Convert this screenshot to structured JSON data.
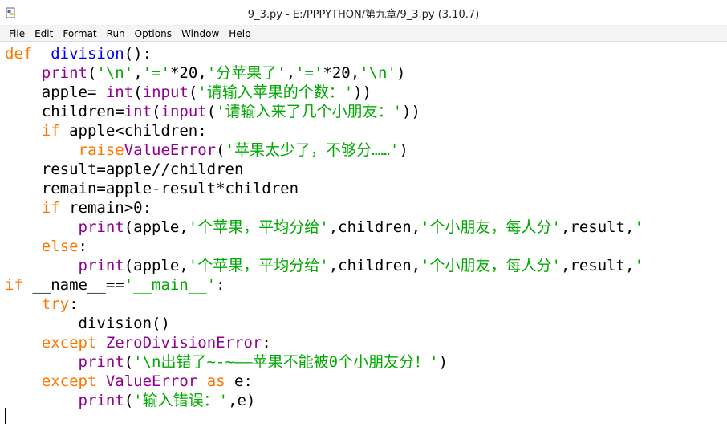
{
  "window": {
    "title": "9_3.py - E:/PPPYTHON/第九章/9_3.py (3.10.7)"
  },
  "menu": [
    "File",
    "Edit",
    "Format",
    "Run",
    "Options",
    "Window",
    "Help"
  ],
  "colors": {
    "keyword": "#ff7700",
    "builtin": "#900090",
    "string": "#00aa00",
    "definition": "#0000ff"
  },
  "code": [
    [
      [
        "kw",
        "def"
      ],
      [
        "",
        "  "
      ],
      [
        "df",
        "division"
      ],
      [
        "",
        "():"
      ]
    ],
    [
      [
        "",
        "    "
      ],
      [
        "bi",
        "print"
      ],
      [
        "",
        "("
      ],
      [
        "st",
        "'\\n'"
      ],
      [
        "",
        ","
      ],
      [
        "st",
        "'='"
      ],
      [
        "",
        "*20,"
      ],
      [
        "st",
        "'分苹果了'"
      ],
      [
        "",
        ","
      ],
      [
        "st",
        "'='"
      ],
      [
        "",
        "*20,"
      ],
      [
        "st",
        "'\\n'"
      ],
      [
        "",
        ")"
      ]
    ],
    [
      [
        "",
        "    apple= "
      ],
      [
        "bi",
        "int"
      ],
      [
        "",
        "("
      ],
      [
        "bi",
        "input"
      ],
      [
        "",
        "("
      ],
      [
        "st",
        "'请输入苹果的个数：'"
      ],
      [
        "",
        "))"
      ]
    ],
    [
      [
        "",
        "    children="
      ],
      [
        "bi",
        "int"
      ],
      [
        "",
        "("
      ],
      [
        "bi",
        "input"
      ],
      [
        "",
        "("
      ],
      [
        "st",
        "'请输入来了几个小朋友：'"
      ],
      [
        "",
        "))"
      ]
    ],
    [
      [
        "",
        "    "
      ],
      [
        "kw",
        "if"
      ],
      [
        "",
        " apple<children:"
      ]
    ],
    [
      [
        "",
        "        "
      ],
      [
        "kw",
        "raise"
      ],
      [
        "",
        "",
        " "
      ],
      [
        "bi",
        "ValueError"
      ],
      [
        "",
        "("
      ],
      [
        "st",
        "'苹果太少了，不够分……'"
      ],
      [
        "",
        ")"
      ]
    ],
    [
      [
        "",
        "    result=apple//children"
      ]
    ],
    [
      [
        "",
        "    remain=apple-result*children"
      ]
    ],
    [
      [
        "",
        "    "
      ],
      [
        "kw",
        "if"
      ],
      [
        "",
        " remain>0:"
      ]
    ],
    [
      [
        "",
        "        "
      ],
      [
        "bi",
        "print"
      ],
      [
        "",
        "(apple,"
      ],
      [
        "st",
        "'个苹果，平均分给'"
      ],
      [
        "",
        ",children,"
      ],
      [
        "st",
        "'个小朋友，每人分'"
      ],
      [
        "",
        ",result,"
      ],
      [
        "st",
        "'"
      ]
    ],
    [
      [
        "",
        "    "
      ],
      [
        "kw",
        "else"
      ],
      [
        "",
        ":"
      ]
    ],
    [
      [
        "",
        "        "
      ],
      [
        "bi",
        "print"
      ],
      [
        "",
        "(apple,"
      ],
      [
        "st",
        "'个苹果，平均分给'"
      ],
      [
        "",
        ",children,"
      ],
      [
        "st",
        "'个小朋友，每人分'"
      ],
      [
        "",
        ",result,"
      ],
      [
        "st",
        "'"
      ]
    ],
    [
      [
        "kw",
        "if"
      ],
      [
        "",
        " __name__=="
      ],
      [
        "st",
        "'__main__'"
      ],
      [
        "",
        ":"
      ]
    ],
    [
      [
        "",
        "    "
      ],
      [
        "kw",
        "try"
      ],
      [
        "",
        ":"
      ]
    ],
    [
      [
        "",
        "        division()"
      ]
    ],
    [
      [
        "",
        "    "
      ],
      [
        "kw",
        "except"
      ],
      [
        "",
        " "
      ],
      [
        "bi",
        "ZeroDivisionError"
      ],
      [
        "",
        ":"
      ]
    ],
    [
      [
        "",
        "        "
      ],
      [
        "bi",
        "print"
      ],
      [
        "",
        "("
      ],
      [
        "st",
        "'\\n出错了~-~——苹果不能被0个小朋友分！'"
      ],
      [
        "",
        ")"
      ]
    ],
    [
      [
        "",
        "    "
      ],
      [
        "kw",
        "except"
      ],
      [
        "",
        " "
      ],
      [
        "bi",
        "ValueError"
      ],
      [
        "",
        " "
      ],
      [
        "kw",
        "as"
      ],
      [
        "",
        " e:"
      ]
    ],
    [
      [
        "",
        "        "
      ],
      [
        "bi",
        "print"
      ],
      [
        "",
        "("
      ],
      [
        "st",
        "'输入错误：'"
      ],
      [
        "",
        ",e)"
      ]
    ]
  ]
}
